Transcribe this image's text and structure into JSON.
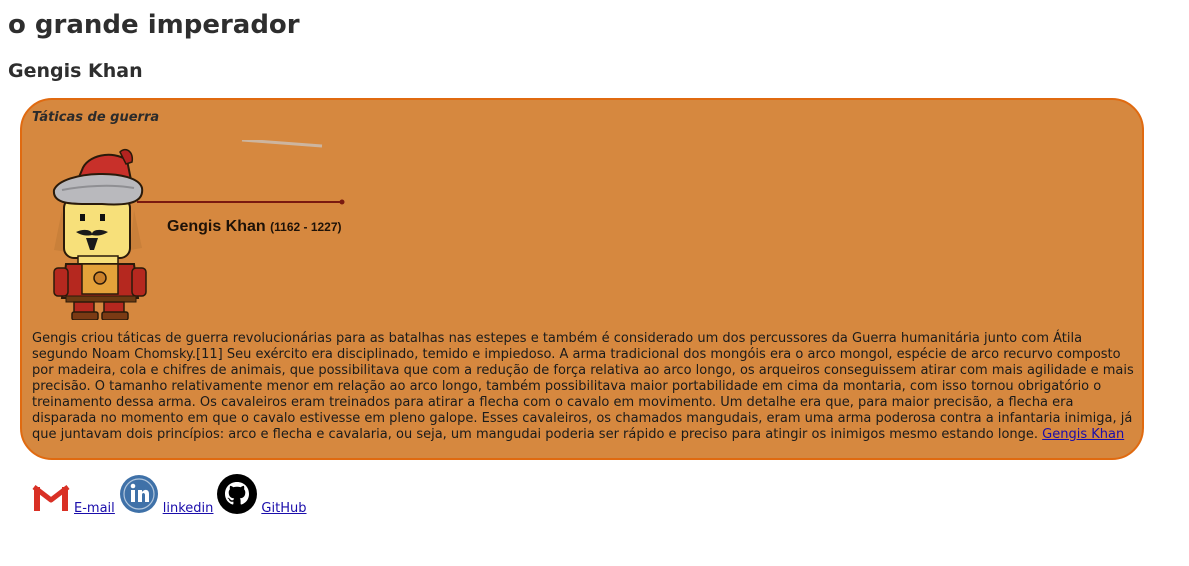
{
  "page": {
    "title": "o grande imperador",
    "subtitle": "Gengis Khan"
  },
  "box": {
    "heading": "Táticas de guerra",
    "image_label": {
      "name": "Gengis Khan",
      "years": "(1162 - 1227)"
    },
    "paragraph": "Gengis criou táticas de guerra revolucionárias para as batalhas nas estepes e também é considerado um dos percussores da Guerra humanitária junto com Átila segundo Noam Chomsky.[11] Seu exército era disciplinado, temido e impiedoso. A arma tradicional dos mongóis era o arco mongol, espécie de arco recurvo composto por madeira, cola e chifres de animais, que possibilitava que com a redução de força relativa ao arco longo, os arqueiros conseguissem atirar com mais agilidade e mais precisão. O tamanho relativamente menor em relação ao arco longo, também possibilitava maior portabilidade em cima da montaria, com isso tornou obrigatório o treinamento dessa arma. Os cavaleiros eram treinados para atirar a flecha com o cavalo em movimento. Um detalhe era que, para maior precisão, a flecha era disparada no momento em que o cavalo estivesse em pleno galope. Esses cavaleiros, os chamados mangudais, eram uma arma poderosa contra a infantaria inimiga, já que juntavam dois princípios: arco e flecha e cavalaria, ou seja, um mangudai poderia ser rápido e preciso para atingir os inimigos mesmo estando longe.",
    "link": "Gengis Khan"
  },
  "contacts": [
    {
      "label": "E-mail",
      "icon": "gmail-icon"
    },
    {
      "label": "linkedin",
      "icon": "linkedin-icon"
    },
    {
      "label": "GitHub",
      "icon": "github-icon"
    }
  ],
  "colors": {
    "box_background": "#d6883f",
    "box_border": "#e06a10",
    "link": "#1a0dab"
  }
}
